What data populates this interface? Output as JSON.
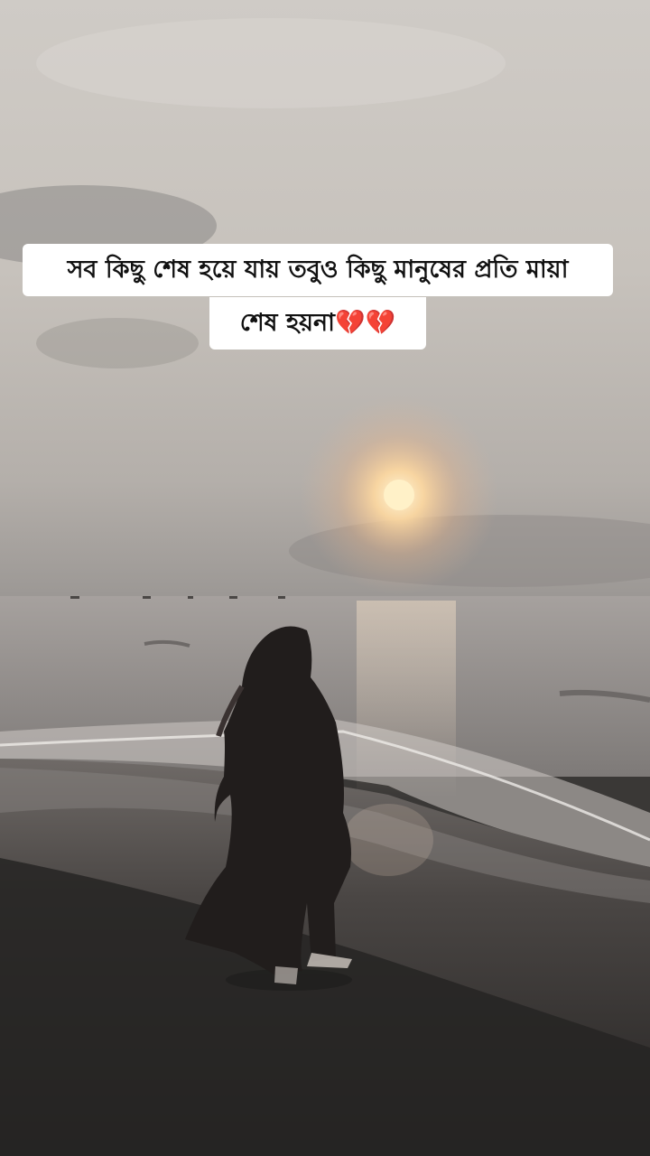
{
  "caption": {
    "line1": "সব কিছু শেষ হয়ে যায় তবুও কিছু মানুষের প্রতি মায়া",
    "line2": "শেষ হয়না",
    "emoji": "💔💔"
  },
  "colors": {
    "sky": "#c9c5bf",
    "sea": "#8f8b88",
    "sand": "#2d2b2a",
    "sun": "#fff1c8",
    "caption_bg": "#ffffff"
  }
}
